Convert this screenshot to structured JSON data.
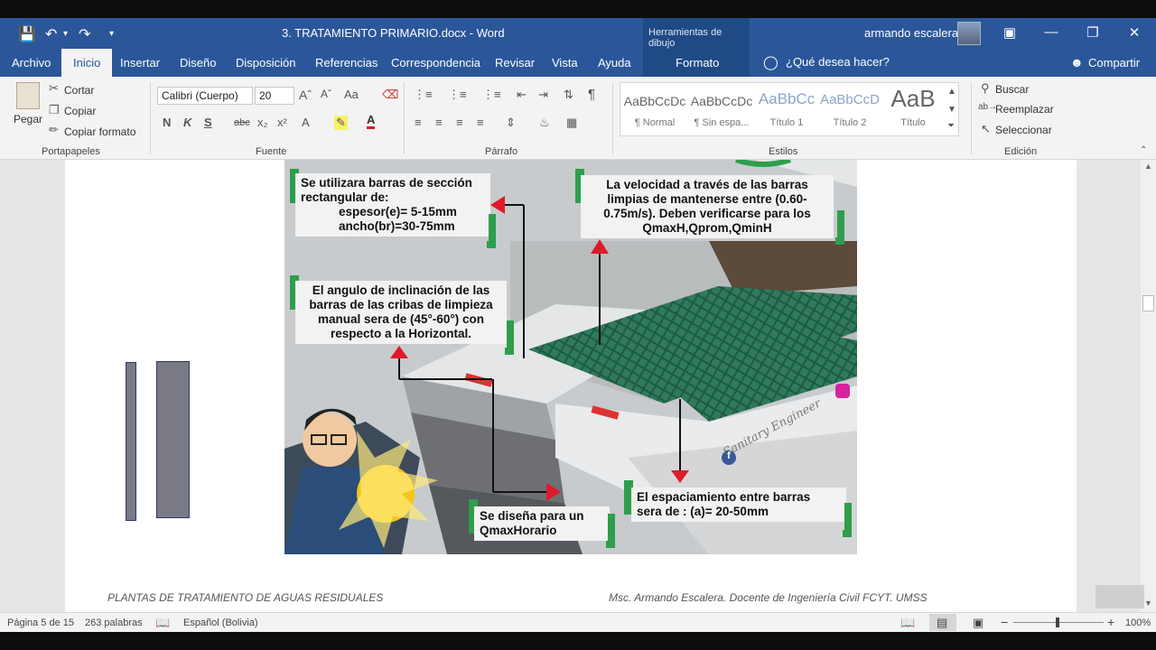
{
  "window": {
    "doc_title": "3. TRATAMIENTO PRIMARIO.docx  -  Word",
    "context_tab_group": "Herramientas de dibujo",
    "user_name": "armando escalera"
  },
  "tabs": [
    "Archivo",
    "Inicio",
    "Insertar",
    "Diseño",
    "Disposición",
    "Referencias",
    "Correspondencia",
    "Revisar",
    "Vista",
    "Ayuda",
    "Formato"
  ],
  "tell_me": "¿Qué desea hacer?",
  "share": "Compartir",
  "clipboard": {
    "paste": "Pegar",
    "cut": "Cortar",
    "copy": "Copiar",
    "format_painter": "Copiar formato",
    "label": "Portapapeles"
  },
  "font": {
    "family": "Calibri (Cuerpo)",
    "size": "20",
    "label": "Fuente",
    "bold": "N",
    "italic": "K",
    "underline": "S"
  },
  "paragraph": {
    "label": "Párrafo"
  },
  "styles": {
    "label": "Estilos",
    "items": [
      {
        "sample": "AaBbCcDc",
        "name": "¶ Normal"
      },
      {
        "sample": "AaBbCcDc",
        "name": "¶ Sin espa..."
      },
      {
        "sample": "AaBbCc",
        "name": "Título 1"
      },
      {
        "sample": "AaBbCcD",
        "name": "Título 2"
      },
      {
        "sample": "AaB",
        "name": "Título"
      }
    ]
  },
  "editing": {
    "find": "Buscar",
    "replace": "Reemplazar",
    "select": "Seleccionar",
    "label": "Edición"
  },
  "figure": {
    "callout_1": [
      "Se utilizara barras de sección",
      "rectangular de:",
      "espesor(e)= 5-15mm",
      "ancho(br)=30-75mm"
    ],
    "callout_2": [
      "La velocidad  a través de las barras",
      "limpias de mantenerse entre (0.60-",
      "0.75m/s). Deben verificarse para los",
      "QmaxH,Qprom,QminH"
    ],
    "callout_3": [
      "El angulo de inclinación de las",
      "barras de las cribas de limpieza",
      "manual sera de (45°-60°) con",
      "respecto a la Horizontal."
    ],
    "callout_4": [
      "Se diseña para un",
      "QmaxHorario"
    ],
    "callout_5": [
      "El espaciamiento entre barras",
      "sera de : (a)= 20-50mm"
    ],
    "watermark": "Sanitary Engineer"
  },
  "footer": {
    "left": "PLANTAS DE TRATAMIENTO DE AGUAS RESIDUALES",
    "right": "Msc. Armando Escalera. Docente de Ingeniería Civil FCYT. UMSS"
  },
  "status": {
    "page": "Página 5 de 15",
    "words": "263 palabras",
    "language": "Español (Bolivia)",
    "zoom": "100%"
  },
  "colors": {
    "word_blue": "#2b579a",
    "callout_green": "#2e9e4c",
    "arrow_red": "#e0192b"
  }
}
